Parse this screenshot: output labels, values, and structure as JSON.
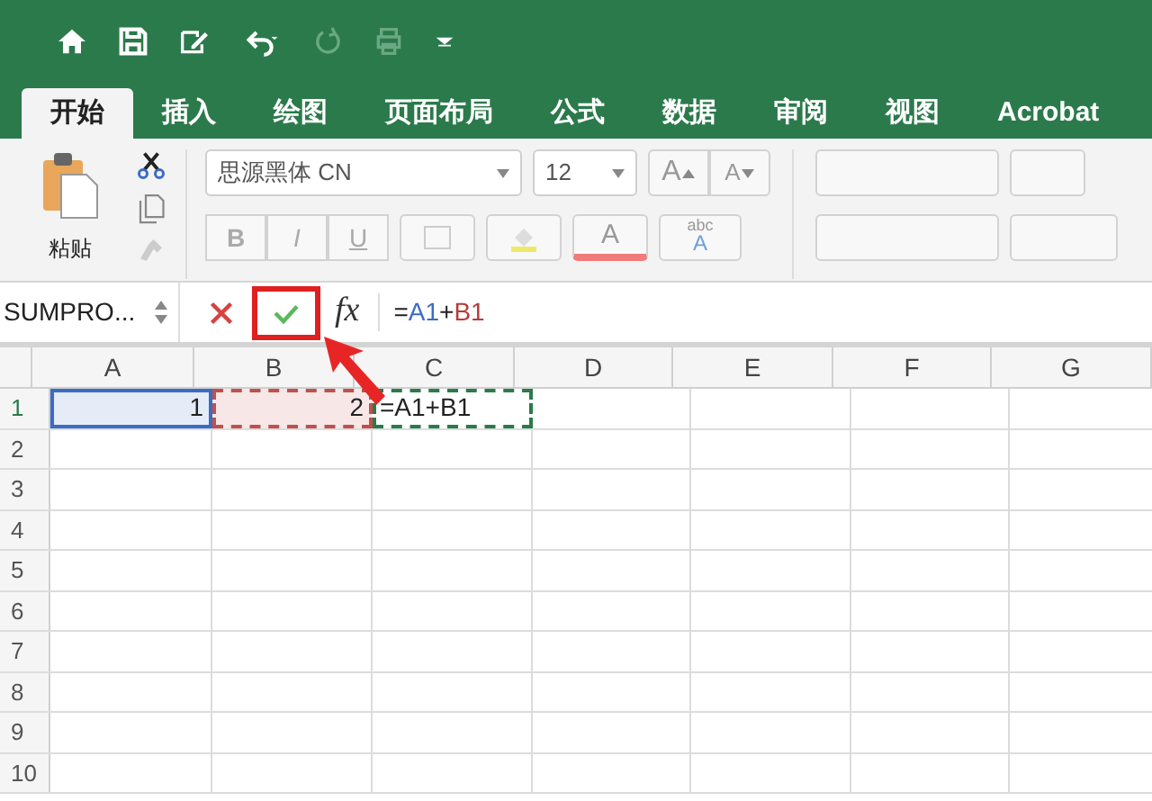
{
  "tabs": [
    {
      "label": "开始",
      "selected": true
    },
    {
      "label": "插入",
      "selected": false
    },
    {
      "label": "绘图",
      "selected": false
    },
    {
      "label": "页面布局",
      "selected": false
    },
    {
      "label": "公式",
      "selected": false
    },
    {
      "label": "数据",
      "selected": false
    },
    {
      "label": "审阅",
      "selected": false
    },
    {
      "label": "视图",
      "selected": false
    },
    {
      "label": "Acrobat",
      "selected": false
    }
  ],
  "ribbon": {
    "paste_label": "粘贴",
    "font_name": "思源黑体 CN",
    "font_size": "12",
    "grow_font": "A",
    "shrink_font": "A",
    "format_buttons": [
      "B",
      "I",
      "U"
    ],
    "font_color": "A",
    "phonetic_top": "abc",
    "phonetic_bottom": "A"
  },
  "formula_bar": {
    "name_box": "SUMPRO...",
    "fx": "fx",
    "formula": [
      {
        "text": "=",
        "color": "#222222"
      },
      {
        "text": "A1",
        "color": "#3b6cc4"
      },
      {
        "text": "+",
        "color": "#222222"
      },
      {
        "text": "B1",
        "color": "#b83a3a"
      }
    ]
  },
  "grid": {
    "columns": [
      "A",
      "B",
      "C",
      "D",
      "E",
      "F",
      "G"
    ],
    "rows": [
      {
        "label": "1",
        "cells": [
          {
            "text": "1",
            "kind": "reference",
            "color": "#3b6cc4"
          },
          {
            "text": "2",
            "kind": "reference",
            "color": "#c0504d"
          },
          {
            "text": "=A1+B1",
            "kind": "editing"
          }
        ]
      },
      {
        "label": "2"
      },
      {
        "label": "3"
      },
      {
        "label": "4"
      },
      {
        "label": "5"
      },
      {
        "label": "6"
      },
      {
        "label": "7"
      },
      {
        "label": "8"
      },
      {
        "label": "9"
      },
      {
        "label": "10"
      }
    ]
  }
}
